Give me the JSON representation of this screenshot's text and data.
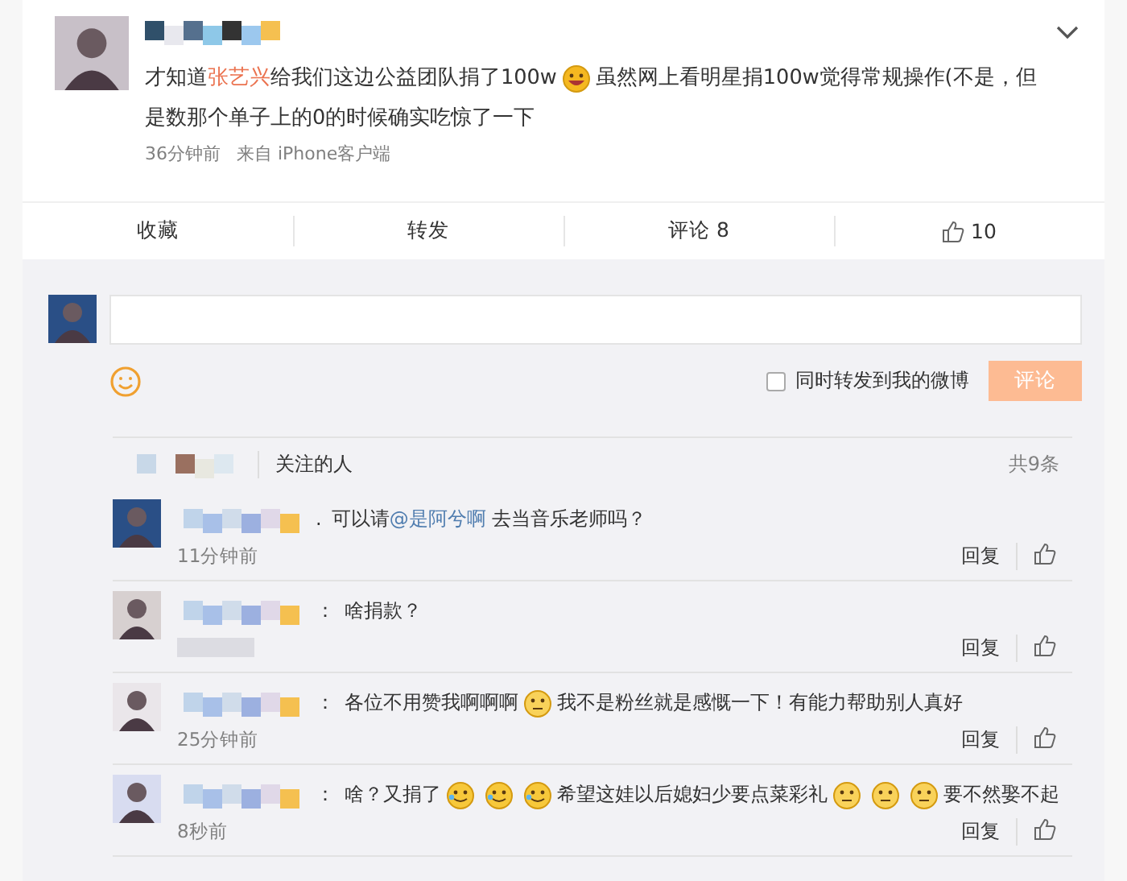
{
  "post": {
    "text": [
      {
        "kind": "text",
        "text": "才知道"
      },
      {
        "kind": "highlight",
        "text": "张艺兴"
      },
      {
        "kind": "text",
        "text": "给我们这边公益团队捐了100w"
      },
      {
        "kind": "laugh-emoji"
      },
      {
        "kind": "text",
        "text": "虽然网上看明星捐100w觉得常规操作(不是，但是数那个单子上的0的时候确实吃惊了一下"
      }
    ],
    "time": "36分钟前",
    "source": "来自 iPhone客户端"
  },
  "actions": [
    {
      "kind": "text",
      "label": "收藏"
    },
    {
      "kind": "text",
      "label": "转发"
    },
    {
      "kind": "text",
      "label": "评论 8"
    },
    {
      "kind": "like",
      "label": "10"
    }
  ],
  "composer": {
    "checkbox": {
      "label": "同时转发到我的微博",
      "checked": false
    },
    "submit": "评论"
  },
  "tabs": [
    {
      "label": "关注的人",
      "selected": false
    }
  ],
  "count": "共9条",
  "comments": [
    {
      "separator": ".",
      "text": [
        {
          "kind": "text",
          "text": "可以请"
        },
        {
          "kind": "mention",
          "text": "@是阿兮啊"
        },
        {
          "kind": "text",
          "text": " 去当音乐老师吗？"
        }
      ],
      "time": "11分钟前",
      "reply": "回复"
    },
    {
      "separator": "：",
      "text": [
        {
          "kind": "text",
          "text": "啥捐款？"
        }
      ],
      "reply": "回复"
    },
    {
      "separator": "：",
      "text": [
        {
          "kind": "text",
          "text": "各位不用赞我啊啊啊"
        },
        {
          "kind": "plain-emoji"
        },
        {
          "kind": "text",
          "text": "我不是粉丝就是感慨一下！有能力帮助别人真好"
        }
      ],
      "time": "25分钟前",
      "reply": "回复"
    },
    {
      "separator": "：",
      "text": [
        {
          "kind": "text",
          "text": "啥？又捐了"
        },
        {
          "kind": "cry-emoji"
        },
        {
          "kind": "cry-emoji"
        },
        {
          "kind": "cry-emoji"
        },
        {
          "kind": "text",
          "text": "希望这娃以后媳妇少要点菜彩礼"
        },
        {
          "kind": "plain-emoji"
        },
        {
          "kind": "plain-emoji"
        },
        {
          "kind": "plain-emoji"
        },
        {
          "kind": "text",
          "text": "要不然娶不起"
        }
      ],
      "time": "8秒前",
      "reply": "回复"
    }
  ]
}
